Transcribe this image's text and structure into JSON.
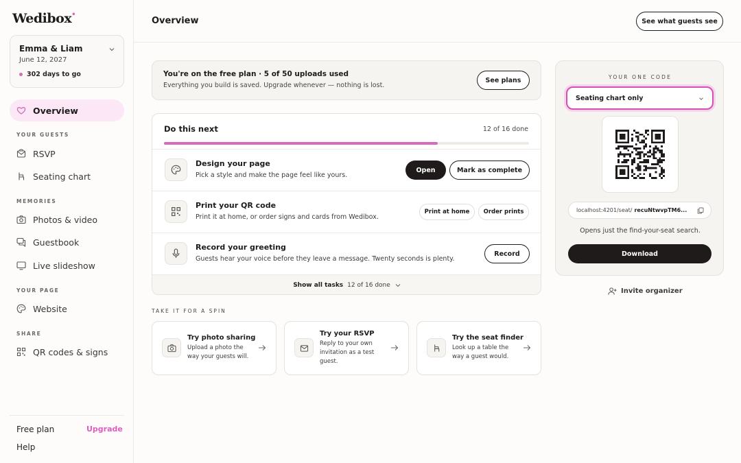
{
  "app": {
    "logo_text": "Wedibox",
    "logo_mark": "•"
  },
  "event": {
    "name": "Emma & Liam",
    "date": "June 12, 2027",
    "countdown": "302 days to go"
  },
  "sidebar": {
    "overview": "Overview",
    "sections": {
      "guests": "YOUR GUESTS",
      "memories": "MEMORIES",
      "page": "YOUR PAGE",
      "share": "SHARE"
    },
    "items": {
      "rsvp": "RSVP",
      "seating": "Seating chart",
      "photos": "Photos & video",
      "guestbook": "Guestbook",
      "slideshow": "Live slideshow",
      "website": "Website",
      "qr": "QR codes & signs"
    },
    "plan": "Free plan",
    "upgrade": "Upgrade",
    "help": "Help"
  },
  "header": {
    "title": "Overview",
    "guest_view_button": "See what guests see"
  },
  "banner": {
    "title": "You're on the free plan · 5 of 50 uploads used",
    "subtitle": "Everything you build is saved. Upgrade whenever — nothing is lost.",
    "button": "See plans"
  },
  "tasks": {
    "title": "Do this next",
    "count": "12 of 16 done",
    "progress": 0.75,
    "items": [
      {
        "name": "Design your page",
        "desc": "Pick a style and make the page feel like yours.",
        "primary": "Open",
        "secondary": "Mark as complete"
      },
      {
        "name": "Print your QR code",
        "desc": "Print it at home, or order signs and cards from Wedibox.",
        "primary": "Print at home",
        "secondary": "Order prints"
      },
      {
        "name": "Record your greeting",
        "desc": "Guests hear your voice before they leave a message. Twenty seconds is plenty.",
        "primary": "Record"
      }
    ],
    "footer_label": "Show all tasks",
    "footer_count": "12 of 16 done"
  },
  "spin": {
    "label": "TAKE IT FOR A SPIN",
    "cards": [
      {
        "title": "Try photo sharing",
        "desc": "Upload a photo the way your guests will."
      },
      {
        "title": "Try your RSVP",
        "desc": "Reply to your own invitation as a test guest."
      },
      {
        "title": "Try the seat finder",
        "desc": "Look up a table the way a guest would."
      }
    ]
  },
  "code_panel": {
    "heading": "YOUR ONE CODE",
    "selected": "Seating chart only",
    "url_host": "localhost:4201/seat/",
    "url_code": "recuNtwvpTM6...",
    "note": "Opens just the find-your-seat search.",
    "download": "Download",
    "invite": "Invite organizer"
  },
  "colors": {
    "accent": "#e05cc1",
    "active_bg": "#fbe7f5",
    "progress": "#d86bbd",
    "dark": "#1e1b1a"
  }
}
